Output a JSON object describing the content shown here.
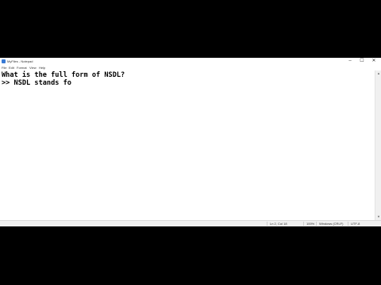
{
  "window": {
    "title": "MyFiles - Notepad",
    "controls": {
      "minimize": "–",
      "maximize": "☐",
      "close": "✕"
    }
  },
  "menu": {
    "file": "File",
    "edit": "Edit",
    "format": "Format",
    "view": "View",
    "help": "Help"
  },
  "editor": {
    "lines": [
      "What is the full form of NSDL?",
      ">> NSDL stands fo"
    ]
  },
  "status": {
    "position": "Ln 2, Col 18",
    "zoom": "100%",
    "line_ending": "Windows (CRLF)",
    "encoding": "UTF-8"
  },
  "icons": {
    "app": "notepad-icon"
  }
}
